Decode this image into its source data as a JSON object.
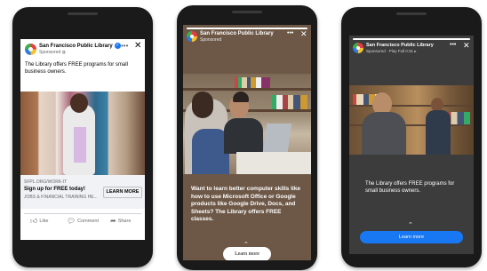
{
  "ads": [
    {
      "page_name": "San Francisco Public Library",
      "sponsored": "Sponsored",
      "globe_icon": "globe-icon",
      "caption": "The Library offers FREE programs for small business owners.",
      "link_url": "SFPL.ORG/WORK-IT",
      "headline": "Sign up for FREE today!",
      "description": "JOBS & FINANCIAL TRAINING HE...",
      "cta": "LEARN MORE",
      "actions": {
        "like": "Like",
        "comment": "Comment",
        "share": "Share"
      }
    },
    {
      "page_name": "San Francisco Public Library",
      "sponsored": "Sponsored",
      "body": "Want to learn better computer skills like how to use Microsoft Office or Google products like Google Drive, Docs, and Sheets? The Library offers FREE classes.",
      "cta": "Learn more",
      "progress": 1.0
    },
    {
      "page_name": "San Francisco Public Library",
      "sponsored": "Sponsored · Play Full 0:31 ▸",
      "body": "The Library offers FREE programs for small business owners.",
      "cta": "Learn more"
    }
  ],
  "colors": {
    "facebook_blue": "#1877f2",
    "story_brown": "#6d5847",
    "story_dark": "#3c3c3c",
    "cta_blue": "#1877f2"
  }
}
